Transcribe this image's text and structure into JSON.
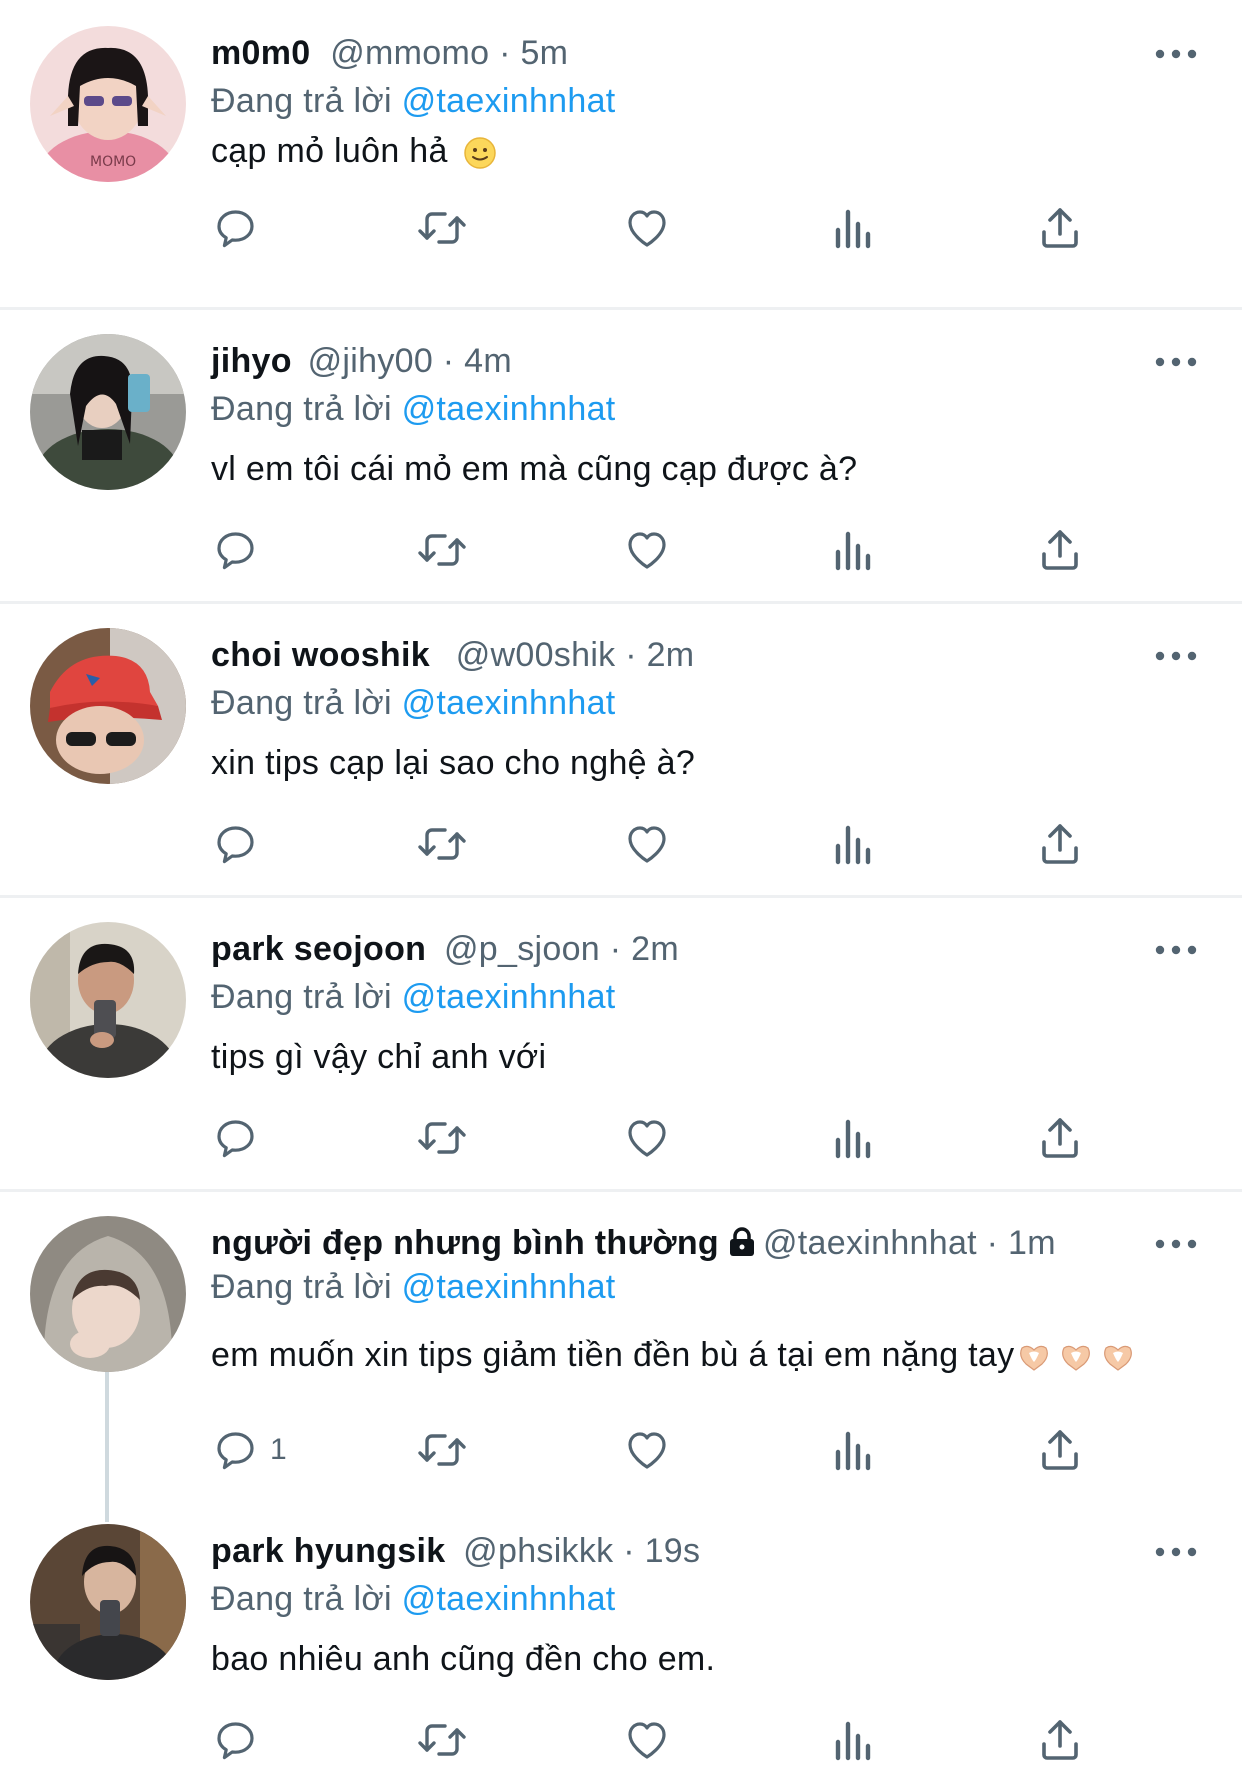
{
  "tweets": [
    {
      "name": "m0m0",
      "handle": "@mmomo",
      "dot": "·",
      "time": "5m",
      "replying_prefix": "Đang trả lời",
      "replying_to": "@taexinhnhat",
      "text": "cạp mỏ luôn hả",
      "emoji": "slightly-smiling-face",
      "reply_count": "",
      "avatar": "avatar-photo-girl-pink-shirt"
    },
    {
      "name": "jihyo",
      "handle": "@jihy00",
      "dot": "·",
      "time": "4m",
      "replying_prefix": "Đang trả lời",
      "replying_to": "@taexinhnhat",
      "text": "vl em tôi cái mỏ em mà cũng cạp được à?",
      "reply_count": "",
      "avatar": "avatar-photo-girl-mirror"
    },
    {
      "name": "choi wooshik",
      "handle": "@w00shik",
      "dot": "·",
      "time": "2m",
      "replying_prefix": "Đang trả lời",
      "replying_to": "@taexinhnhat",
      "text": "xin tips cạp lại sao cho nghệ à?",
      "reply_count": "",
      "avatar": "avatar-photo-red-cap"
    },
    {
      "name": "park seojoon",
      "handle": "@p_sjoon",
      "dot": "·",
      "time": "2m",
      "replying_prefix": "Đang trả lời",
      "replying_to": "@taexinhnhat",
      "text": "tips gì vậy chỉ anh với",
      "reply_count": "",
      "avatar": "avatar-photo-man-selfie"
    },
    {
      "name": "người đẹp nhưng bình thường",
      "lock": "lock-icon",
      "handle": "@taexinhnhat",
      "dot": "·",
      "time": "1m",
      "replying_prefix": "Đang trả lời",
      "replying_to": "@taexinhnhat",
      "text": "em muốn xin tips giảm tiền đền bù á tại em nặng tay",
      "emoji": "heart-hands x3",
      "reply_count": "1",
      "avatar": "avatar-photo-hoodie"
    },
    {
      "name": "park hyungsik",
      "handle": "@phsikkk",
      "dot": "·",
      "time": "19s",
      "replying_prefix": "Đang trả lời",
      "replying_to": "@taexinhnhat",
      "text": "bao nhiêu anh cũng đền cho em.",
      "reply_count": "",
      "avatar": "avatar-photo-man-phone"
    }
  ],
  "icons": {
    "reply": "reply-icon",
    "retweet": "retweet-icon",
    "like": "like-icon",
    "views": "views-icon",
    "share": "share-icon",
    "more": "more-icon"
  },
  "colors": {
    "link": "#1d9bf0",
    "secondary_text": "#536471",
    "icon": "#536471",
    "divider": "#eef0f2",
    "thread_line": "#cfd9de"
  }
}
